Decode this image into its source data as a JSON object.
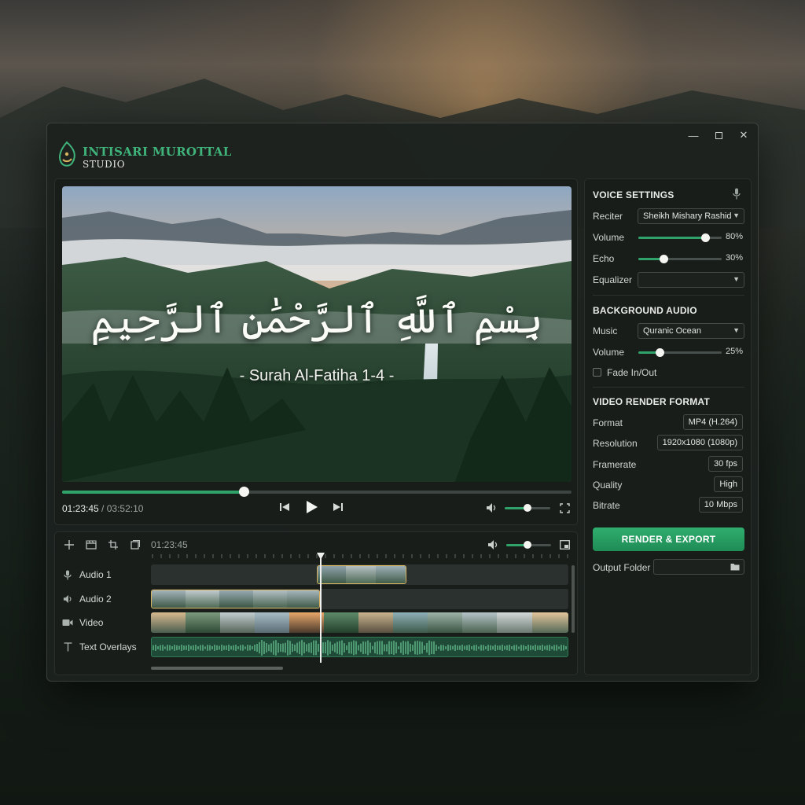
{
  "app": {
    "brand_line1": "INTISARI MUROTTAL",
    "brand_line2": "STUDIO",
    "accent_color": "#2fa36a",
    "window_controls": [
      "minimize-icon",
      "maximize-icon",
      "close-icon"
    ]
  },
  "preview": {
    "arabic_text": "بِسْمِ ٱللَّهِ ٱلرَّحْمَٰنِ ٱلرَّحِيمِ",
    "surah_caption": "- Surah Al-Fatiha 1-4 -",
    "current_time": "01:23:45",
    "time_separator": " / ",
    "total_time": "03:52:10",
    "progress": 0.357,
    "volume": 0.5
  },
  "timeline": {
    "current_time": "01:23:45",
    "tools": [
      "plus-icon",
      "clapperboard-icon",
      "crop-icon",
      "layers-icon"
    ],
    "volume": 0.47,
    "tracks": [
      {
        "label": "Audio 1",
        "icon": "microphone-icon"
      },
      {
        "label": "Audio 2",
        "icon": "speaker-icon"
      },
      {
        "label": "Video",
        "icon": "video-camera-icon"
      },
      {
        "label": "Text Overlays",
        "icon": "text-icon"
      }
    ]
  },
  "voice_settings": {
    "title": "VOICE SETTINGS",
    "reciter_label": "Reciter",
    "reciter_value": "Sheikh Mishary Rashid",
    "volume_label": "Volume",
    "volume_value": 0.8,
    "volume_text": "80%",
    "echo_label": "Echo",
    "echo_value": 0.3,
    "echo_text": "30%",
    "equalizer_label": "Equalizer",
    "equalizer_value": ""
  },
  "background_audio": {
    "title": "BACKGROUND AUDIO",
    "music_label": "Music",
    "music_value": "Quranic Ocean",
    "volume_label": "Volume",
    "volume_value": 0.25,
    "volume_text": "25%",
    "fade_label": "Fade In/Out",
    "fade_checked": false
  },
  "render_format": {
    "title": "VIDEO RENDER FORMAT",
    "rows": [
      {
        "label": "Format",
        "value": "MP4 (H.264)"
      },
      {
        "label": "Resolution",
        "value": "1920x1080 (1080p)"
      },
      {
        "label": "Framerate",
        "value": "30 fps"
      },
      {
        "label": "Quality",
        "value": "High"
      },
      {
        "label": "Bitrate",
        "value": "10 Mbps"
      }
    ],
    "render_button": "RENDER & EXPORT",
    "output_folder_label": "Output Folder",
    "output_folder_value": ""
  }
}
